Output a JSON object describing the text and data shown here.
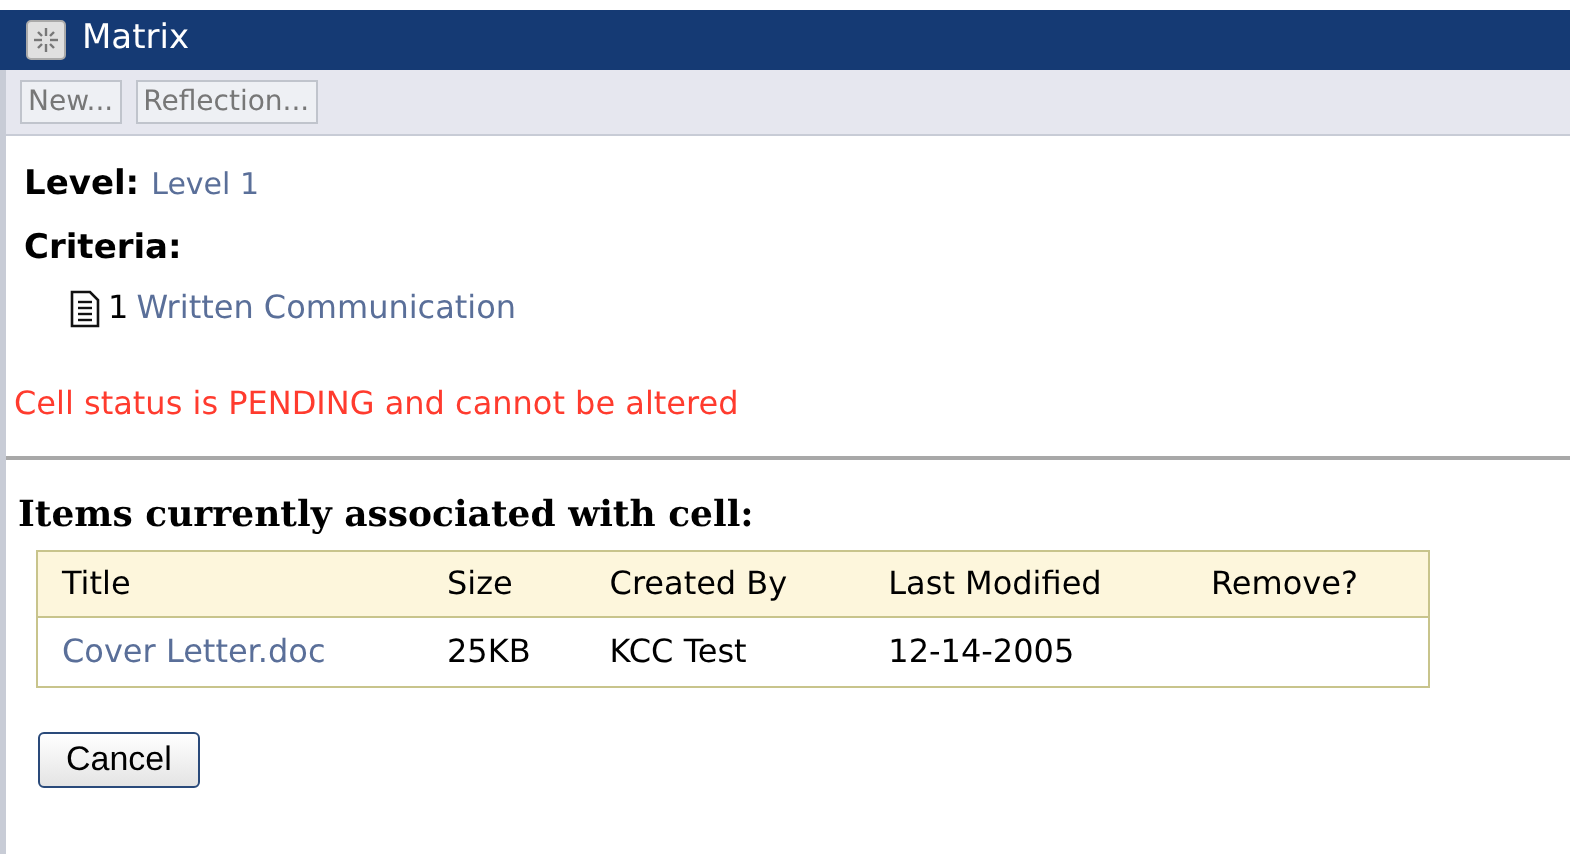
{
  "window": {
    "title": "Matrix"
  },
  "toolbar": [
    "New...",
    "Reflection..."
  ],
  "level": {
    "label": "Level:",
    "value": "Level 1"
  },
  "criteria": {
    "label": "Criteria:",
    "items": [
      {
        "number": "1",
        "name": "Written Communication"
      }
    ]
  },
  "status_message": "Cell status is PENDING and cannot be altered",
  "items_heading": "Items currently associated with cell:",
  "table": {
    "columns": [
      "Title",
      "Size",
      "Created By",
      "Last Modified",
      "Remove?"
    ],
    "rows": [
      {
        "title": "Cover Letter.doc",
        "size": "25KB",
        "created_by": "KCC Test",
        "last_modified": "12-14-2005"
      }
    ]
  },
  "buttons": [
    "Cancel"
  ]
}
